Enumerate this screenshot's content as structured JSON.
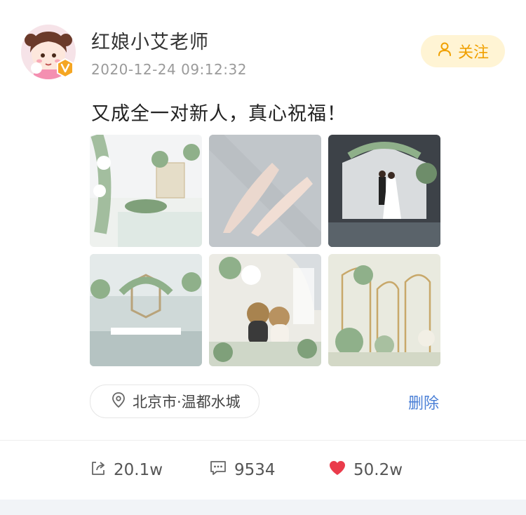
{
  "post": {
    "author": "红娘小艾老师",
    "timestamp": "2020-12-24  09:12:32",
    "follow_label": "关注",
    "text": "又成全一对新人，真心祝福！",
    "location": "北京市·温都水城",
    "delete_label": "删除",
    "photos": [
      {
        "icon": "wedding-ceremony-photo"
      },
      {
        "icon": "bridal-shoes-photo"
      },
      {
        "icon": "couple-stage-photo"
      },
      {
        "icon": "wedding-hall-photo"
      },
      {
        "icon": "teddy-bears-photo"
      },
      {
        "icon": "floral-arch-photo"
      }
    ]
  },
  "stats": {
    "shares": "20.1w",
    "comments": "9534",
    "likes": "50.2w"
  },
  "colors": {
    "follow_bg": "#fff4d4",
    "follow_text": "#f0a000",
    "delete_text": "#4a7fd6",
    "like_heart": "#ea3b4b",
    "timestamp": "#9a9a9a"
  }
}
